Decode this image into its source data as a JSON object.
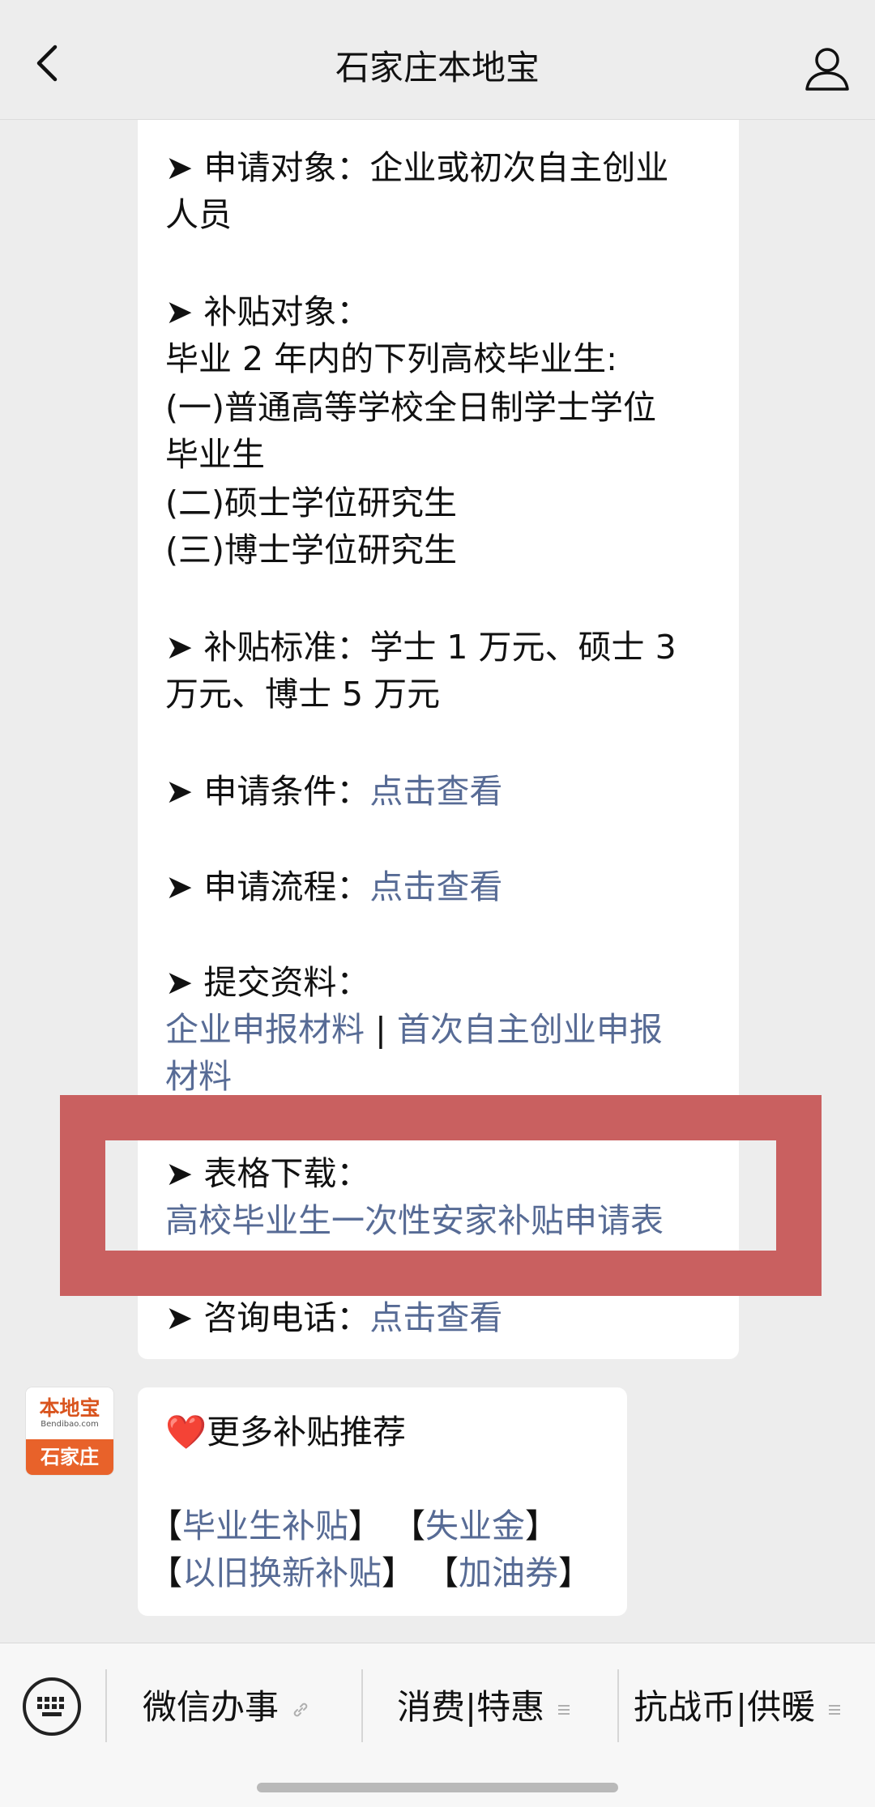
{
  "navbar": {
    "title": "石家庄本地宝",
    "back_icon": "chevron-left-icon",
    "profile_icon": "person-icon"
  },
  "message1": {
    "apply_target": "➤ 申请对象：企业或初次自主创业",
    "apply_target_cont": "人员",
    "subsidy_target": "➤ 补贴对象：",
    "subsidy_desc": "毕业 2 年内的下列高校毕业生:",
    "item1": "(一)普通高等学校全日制学士学位",
    "item1_cont": "毕业生",
    "item2": "(二)硕士学位研究生",
    "item3": "(三)博士学位研究生",
    "standard": "➤ 补贴标准：学士 1 万元、硕士 3",
    "standard_cont": "万元、博士 5 万元",
    "conditions_label": "➤ 申请条件：",
    "conditions_link": "点击查看",
    "process_label": "➤ 申请流程：",
    "process_link": "点击查看",
    "materials_label": "➤ 提交资料：",
    "materials_link1": "企业申报材料",
    "materials_sep": " | ",
    "materials_link2": "首次自主创业申报",
    "materials_link2_cont": "材料",
    "download_label": "➤ 表格下载：",
    "download_link": "高校毕业生一次性安家补贴申请表",
    "consult_label": "➤ 咨询电话：",
    "consult_link": "点击查看"
  },
  "avatar": {
    "logo_text": "本地宝",
    "sub_text": "Bendibao.com",
    "city_text": "石家庄"
  },
  "message2": {
    "heart": "❤️",
    "title": "更多补贴推荐",
    "bracket_open": "【",
    "bracket_close": "】",
    "link1": "毕业生补贴",
    "link2": "失业金",
    "link3": "以旧换新补贴",
    "link4": "加油券"
  },
  "bottom_menu": {
    "keyboard_icon": "keyboard-icon",
    "item1": "微信办事",
    "item1_icon": "link-icon",
    "item2": "消费|特惠",
    "item2_icon": "menu-lines-icon",
    "item3": "抗战币|供暖",
    "item3_icon": "menu-lines-icon"
  },
  "colors": {
    "link": "#576b95",
    "highlight_border": "#c96060",
    "brand_orange": "#e8622a"
  }
}
